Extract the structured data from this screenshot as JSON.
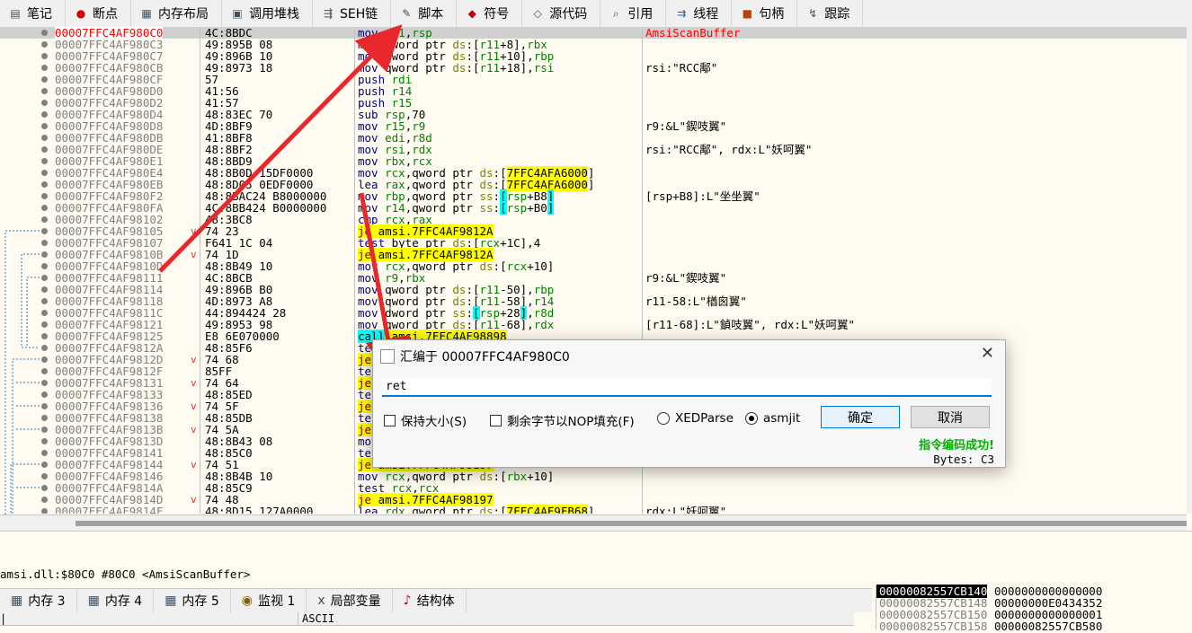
{
  "toolbar": {
    "tabs": [
      {
        "label": "笔记",
        "icon": "note-icon"
      },
      {
        "label": "断点",
        "icon": "breakpoint-icon"
      },
      {
        "label": "内存布局",
        "icon": "memory-map-icon"
      },
      {
        "label": "调用堆栈",
        "icon": "call-stack-icon"
      },
      {
        "label": "SEH链",
        "icon": "seh-icon"
      },
      {
        "label": "脚本",
        "icon": "script-icon"
      },
      {
        "label": "符号",
        "icon": "symbol-icon"
      },
      {
        "label": "源代码",
        "icon": "source-icon"
      },
      {
        "label": "引用",
        "icon": "reference-icon"
      },
      {
        "label": "线程",
        "icon": "thread-icon"
      },
      {
        "label": "句柄",
        "icon": "handle-icon"
      },
      {
        "label": "跟踪",
        "icon": "trace-icon"
      }
    ]
  },
  "disasm": {
    "rows": [
      {
        "addr": "00007FFC4AF980C0",
        "bytes": "4C:8BDC",
        "instr": "mov r11,rsp",
        "comment": "AmsiScanBuffer",
        "selected": true
      },
      {
        "addr": "00007FFC4AF980C3",
        "bytes": "49:895B 08",
        "instr": "mov qword ptr ds:[r11+8],rbx",
        "comment": ""
      },
      {
        "addr": "00007FFC4AF980C7",
        "bytes": "49:896B 10",
        "instr": "mov qword ptr ds:[r11+10],rbp",
        "comment": ""
      },
      {
        "addr": "00007FFC4AF980CB",
        "bytes": "49:8973 18",
        "instr": "mov qword ptr ds:[r11+18],rsi",
        "comment": "rsi:\"RCC鄅\""
      },
      {
        "addr": "00007FFC4AF980CF",
        "bytes": "57",
        "instr": "push rdi",
        "comment": ""
      },
      {
        "addr": "00007FFC4AF980D0",
        "bytes": "41:56",
        "instr": "push r14",
        "comment": ""
      },
      {
        "addr": "00007FFC4AF980D2",
        "bytes": "41:57",
        "instr": "push r15",
        "comment": ""
      },
      {
        "addr": "00007FFC4AF980D4",
        "bytes": "48:83EC 70",
        "instr": "sub rsp,70",
        "comment": ""
      },
      {
        "addr": "00007FFC4AF980D8",
        "bytes": "4D:8BF9",
        "instr": "mov r15,r9",
        "comment": "r9:&L\"鍥吱翼\""
      },
      {
        "addr": "00007FFC4AF980DB",
        "bytes": "41:8BF8",
        "instr": "mov edi,r8d",
        "comment": ""
      },
      {
        "addr": "00007FFC4AF980DE",
        "bytes": "48:8BF2",
        "instr": "mov rsi,rdx",
        "comment": "rsi:\"RCC鄅\", rdx:L\"妖呵翼\""
      },
      {
        "addr": "00007FFC4AF980E1",
        "bytes": "48:8BD9",
        "instr": "mov rbx,rcx",
        "comment": ""
      },
      {
        "addr": "00007FFC4AF980E4",
        "bytes": "48:8B0D 15DF0000",
        "instr": "mov rcx,qword ptr ds:[7FFC4AFA6000]",
        "comment": ""
      },
      {
        "addr": "00007FFC4AF980EB",
        "bytes": "48:8D05 0EDF0000",
        "instr": "lea rax,qword ptr ds:[7FFC4AFA6000]",
        "comment": ""
      },
      {
        "addr": "00007FFC4AF980F2",
        "bytes": "48:8BAC24 B8000000",
        "instr": "mov rbp,qword ptr ss:[rsp+B8]",
        "comment": "[rsp+B8]:L\"坐坐翼\""
      },
      {
        "addr": "00007FFC4AF980FA",
        "bytes": "4C:8BB424 B0000000",
        "instr": "mov r14,qword ptr ss:[rsp+B0]",
        "comment": ""
      },
      {
        "addr": "00007FFC4AF98102",
        "bytes": "48:3BC8",
        "instr": "cmp rcx,rax",
        "comment": ""
      },
      {
        "addr": "00007FFC4AF98105",
        "bytes": "74 23",
        "instr": "je amsi.7FFC4AF9812A",
        "comment": ""
      },
      {
        "addr": "00007FFC4AF98107",
        "bytes": "F641 1C 04",
        "instr": "test byte ptr ds:[rcx+1C],4",
        "comment": ""
      },
      {
        "addr": "00007FFC4AF9810B",
        "bytes": "74 1D",
        "instr": "je amsi.7FFC4AF9812A",
        "comment": ""
      },
      {
        "addr": "00007FFC4AF9810D",
        "bytes": "48:8B49 10",
        "instr": "mov rcx,qword ptr ds:[rcx+10]",
        "comment": ""
      },
      {
        "addr": "00007FFC4AF98111",
        "bytes": "4C:8BCB",
        "instr": "mov r9,rbx",
        "comment": "r9:&L\"鍥吱翼\""
      },
      {
        "addr": "00007FFC4AF98114",
        "bytes": "49:896B B0",
        "instr": "mov qword ptr ds:[r11-50],rbp",
        "comment": ""
      },
      {
        "addr": "00007FFC4AF98118",
        "bytes": "4D:8973 A8",
        "instr": "mov qword ptr ds:[r11-58],r14",
        "comment": "r11-58:L\"楢囪翼\""
      },
      {
        "addr": "00007FFC4AF9811C",
        "bytes": "44:894424 28",
        "instr": "mov dword ptr ss:[rsp+28],r8d",
        "comment": ""
      },
      {
        "addr": "00007FFC4AF98121",
        "bytes": "49:8953 98",
        "instr": "mov qword ptr ds:[r11-68],rdx",
        "comment": "[r11-68]:L\"鍞吱翼\", rdx:L\"妖呵翼\""
      },
      {
        "addr": "00007FFC4AF98125",
        "bytes": "E8 6E070000",
        "instr": "call amsi.7FFC4AF98898",
        "comment": ""
      },
      {
        "addr": "00007FFC4AF9812A",
        "bytes": "48:85F6",
        "instr": "test rsi,rsi",
        "comment": ""
      },
      {
        "addr": "00007FFC4AF9812D",
        "bytes": "74 68",
        "instr": "je amsi.7FFC4AF98197",
        "comment": ""
      },
      {
        "addr": "00007FFC4AF9812F",
        "bytes": "85FF",
        "instr": "test edi,edi",
        "comment": ""
      },
      {
        "addr": "00007FFC4AF98131",
        "bytes": "74 64",
        "instr": "je amsi.7FFC4AF98197",
        "comment": ""
      },
      {
        "addr": "00007FFC4AF98133",
        "bytes": "48:85ED",
        "instr": "test rbp,rbp",
        "comment": ""
      },
      {
        "addr": "00007FFC4AF98136",
        "bytes": "74 5F",
        "instr": "je amsi.7FFC4AF98197",
        "comment": ""
      },
      {
        "addr": "00007FFC4AF98138",
        "bytes": "48:85DB",
        "instr": "test rbx,rbx",
        "comment": ""
      },
      {
        "addr": "00007FFC4AF9813B",
        "bytes": "74 5A",
        "instr": "je amsi.7FFC4AF98197",
        "comment": ""
      },
      {
        "addr": "00007FFC4AF9813D",
        "bytes": "48:8B43 08",
        "instr": "mov rax,qword ptr ds:[rbx+8]",
        "comment": ""
      },
      {
        "addr": "00007FFC4AF98141",
        "bytes": "48:85C0",
        "instr": "test rax,rax",
        "comment": ""
      },
      {
        "addr": "00007FFC4AF98144",
        "bytes": "74 51",
        "instr": "je amsi.7FFC4AF98197",
        "comment": ""
      },
      {
        "addr": "00007FFC4AF98146",
        "bytes": "48:8B4B 10",
        "instr": "mov rcx,qword ptr ds:[rbx+10]",
        "comment": ""
      },
      {
        "addr": "00007FFC4AF9814A",
        "bytes": "48:85C9",
        "instr": "test rcx,rcx",
        "comment": ""
      },
      {
        "addr": "00007FFC4AF9814D",
        "bytes": "74 48",
        "instr": "je amsi.7FFC4AF98197",
        "comment": ""
      },
      {
        "addr": "00007FFC4AF9814F",
        "bytes": "48:8D15 127A0000",
        "instr": "lea rdx,qword ptr ds:[7FFC4AF9FB68]",
        "comment": "rdx:L\"妖呵翼\""
      }
    ]
  },
  "status": {
    "line": "amsi.dll:$80C0 #80C0 <AmsiScanBuffer>"
  },
  "bottom_tabs": [
    {
      "label": "内存 3",
      "icon": "memory-icon"
    },
    {
      "label": "内存 4",
      "icon": "memory-icon"
    },
    {
      "label": "内存 5",
      "icon": "memory-icon"
    },
    {
      "label": "监视 1",
      "icon": "watch-icon"
    },
    {
      "label": "局部变量",
      "icon": "locals-icon"
    },
    {
      "label": "结构体",
      "icon": "struct-icon"
    }
  ],
  "dump": {
    "ascii_header": "ASCII"
  },
  "stack": {
    "rows": [
      {
        "addr": "00000082557CB140",
        "value": "0000000000000000",
        "selected": true
      },
      {
        "addr": "00000082557CB148",
        "value": "00000000E0434352"
      },
      {
        "addr": "00000082557CB150",
        "value": "0000000000000001"
      },
      {
        "addr": "00000082557CB158",
        "value": "00000082557CB580"
      }
    ]
  },
  "dialog": {
    "title": "汇编于 00007FFC4AF980C0",
    "input_value": "ret",
    "keep_size_label": "保持大小(S)",
    "nop_fill_label": "剩余字节以NOP填充(F)",
    "xedparse_label": "XEDParse",
    "asmjit_label": "asmjit",
    "ok_label": "确定",
    "cancel_label": "取消",
    "success_text": "指令编码成功!",
    "bytes_text": "Bytes: C3",
    "close_glyph": "✕"
  },
  "colors": {
    "accent": "#0078d7",
    "arrow": "#e8282c",
    "success": "#00b000"
  }
}
